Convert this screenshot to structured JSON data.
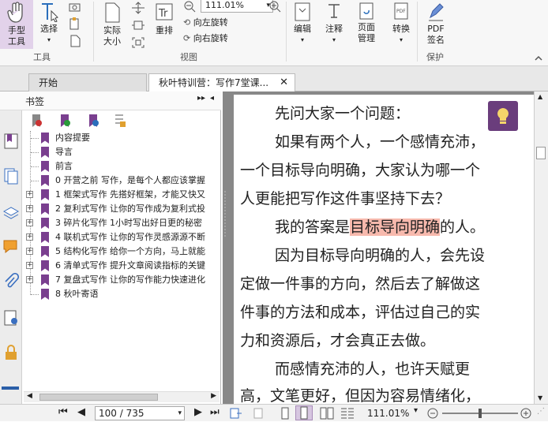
{
  "ribbon": {
    "hand_tool": "手型\n工具",
    "select": "选择",
    "group_tools": "工具",
    "actual_size": "实际\n大小",
    "reflow": "重排",
    "zoom_value": "111.01%",
    "rotate_left": "向左旋转",
    "rotate_right": "向右旋转",
    "group_view": "视图",
    "edit": "编辑",
    "comment": "注释",
    "page_manage": "页面\n管理",
    "convert": "转换",
    "pdf_sign": "PDF\n签名",
    "group_protect": "保护"
  },
  "tabs": {
    "start": "开始",
    "doc": "秋叶特训营：写作7堂课..."
  },
  "sidebar": {
    "title": "书签",
    "bookmarks": [
      {
        "label": "内容提要",
        "expandable": false
      },
      {
        "label": "导言",
        "expandable": false
      },
      {
        "label": "前言",
        "expandable": false
      },
      {
        "label": "0 开营之前 写作，是每个人都应该掌握",
        "expandable": false
      },
      {
        "label": "1 框架式写作 先搭好框架，才能又快又",
        "expandable": true
      },
      {
        "label": "2 复利式写作 让你的写作成为复利式投",
        "expandable": true
      },
      {
        "label": "3 碎片化写作 1小时写出好日更的秘密",
        "expandable": true
      },
      {
        "label": "4 联机式写作 让你的写作灵感源源不断",
        "expandable": true
      },
      {
        "label": "5 结构化写作 给你一个方向，马上就能",
        "expandable": true
      },
      {
        "label": "6 清单式写作 提升文章阅读指标的关键",
        "expandable": true
      },
      {
        "label": "7 复盘式写作 让你的写作能力快速进化",
        "expandable": true
      },
      {
        "label": "8 秋叶寄语",
        "expandable": false
      }
    ]
  },
  "document": {
    "lines": [
      "先问大家一个问题：",
      "如果有两个人，一个感情充沛，",
      "一个目标导向明确，大家认为哪一个",
      "人更能把写作这件事坚持下去？",
      "我的答案是",
      "目标导向明确",
      "的人。",
      "因为目标导向明确的人，会先设",
      "定做一件事的方向，然后去了解做这",
      "件事的方法和成本，评估过自己的实",
      "力和资源后，才会真正去做。",
      "而感情充沛的人，也许天赋更",
      "高，文笔更好，但因为容易情绪化，"
    ]
  },
  "status": {
    "page_value": "100 / 735",
    "zoom": "111.01%"
  },
  "colors": {
    "accent": "#7a3f8f",
    "highlight": "#f7b9ad"
  }
}
